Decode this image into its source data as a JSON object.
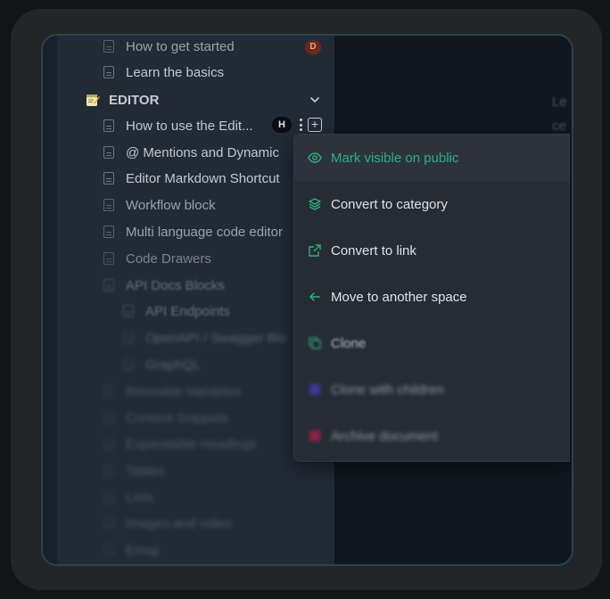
{
  "sidebar": {
    "top_items": [
      {
        "label": "How to get started",
        "badge": "D"
      },
      {
        "label": "Learn the basics"
      }
    ],
    "category": {
      "label": "EDITOR"
    },
    "items": [
      {
        "label": "How to use the Edit...",
        "badge": "H"
      },
      {
        "label": "@ Mentions and Dynamic"
      },
      {
        "label": "Editor Markdown Shortcut"
      },
      {
        "label": "Workflow block"
      },
      {
        "label": "Multi language code editor"
      },
      {
        "label": "Code Drawers"
      },
      {
        "label": "API Docs Blocks"
      }
    ],
    "child_items": [
      {
        "label": "API Endpoints"
      },
      {
        "label": "OpenAPI / Swagger Blo"
      },
      {
        "label": "GraphQL"
      }
    ],
    "blurred_items": [
      {
        "label": "Reusable Variables"
      },
      {
        "label": "Content Snippets"
      },
      {
        "label": "Expandable Headings"
      },
      {
        "label": "Tables"
      },
      {
        "label": "Lists"
      },
      {
        "label": "Images and video"
      },
      {
        "label": "Emoji"
      }
    ]
  },
  "context_menu": {
    "items": [
      {
        "label": "Mark visible on public",
        "icon": "eye-icon",
        "color": "#2fb07c"
      },
      {
        "label": "Convert to category",
        "icon": "layers-icon",
        "color": "#2fb07c"
      },
      {
        "label": "Convert to link",
        "icon": "external-link-icon",
        "color": "#2fb07c"
      },
      {
        "label": "Move to another space",
        "icon": "arrow-left-icon",
        "color": "#2fb07c"
      },
      {
        "label": "Clone",
        "icon": "copy-icon",
        "color": "#2fb07c"
      },
      {
        "label": "Clone with children",
        "icon": "copy-children-icon",
        "color": "#4f46e5"
      },
      {
        "label": "Archive document",
        "icon": "archive-icon",
        "color": "#e11d48"
      }
    ]
  },
  "content": {
    "ghost_lines": [
      "Le",
      "ce"
    ]
  }
}
